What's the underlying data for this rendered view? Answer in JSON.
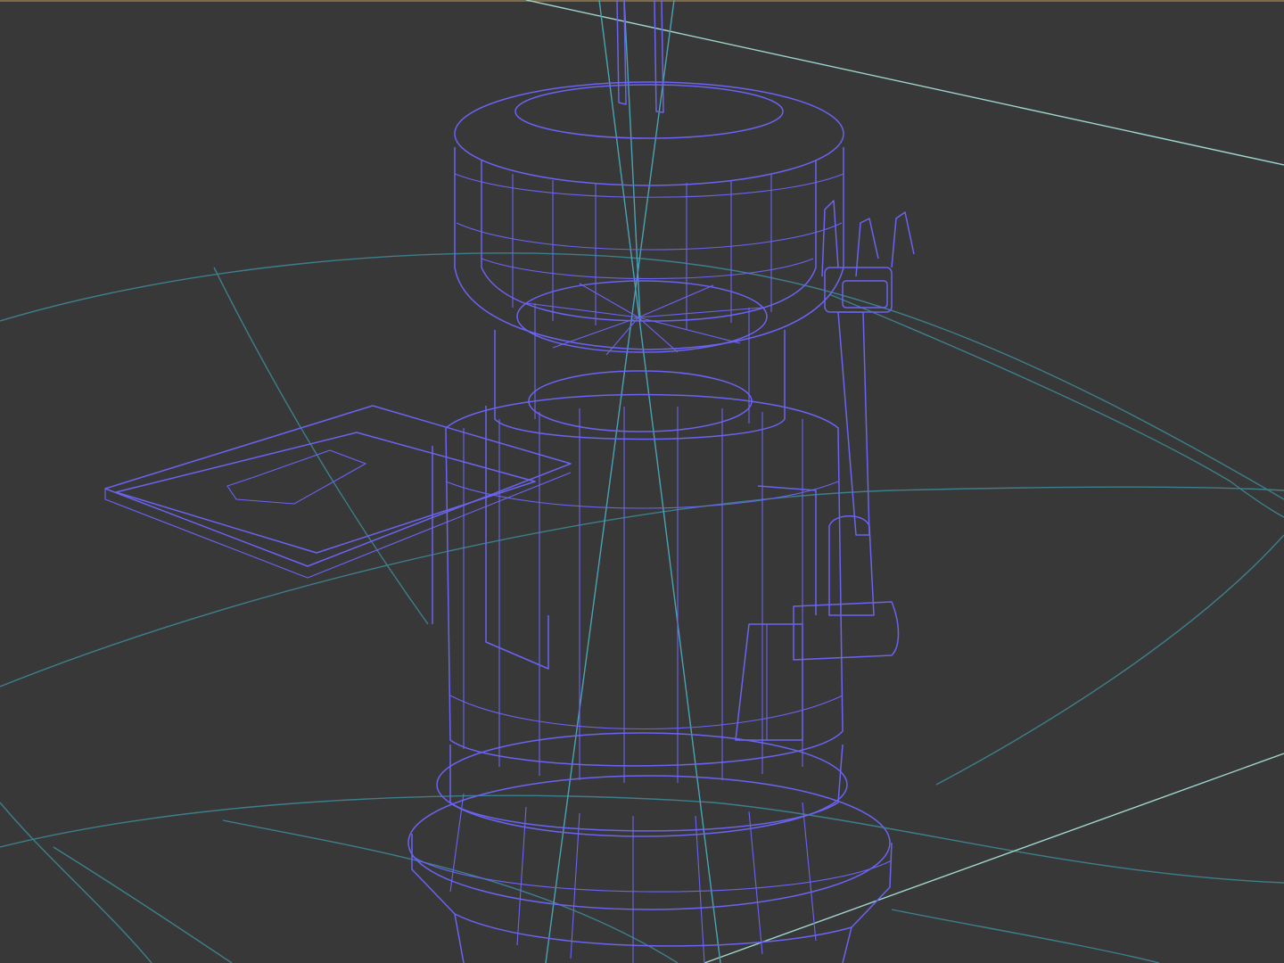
{
  "viewport": {
    "background_color": "#383838",
    "wire_color": "#6b63f2",
    "reference_color": "#4aa3b5",
    "ground_color": "#3d7f8c",
    "light_line_color": "#9fd6cf",
    "top_edge_color": "#7c6b46"
  }
}
